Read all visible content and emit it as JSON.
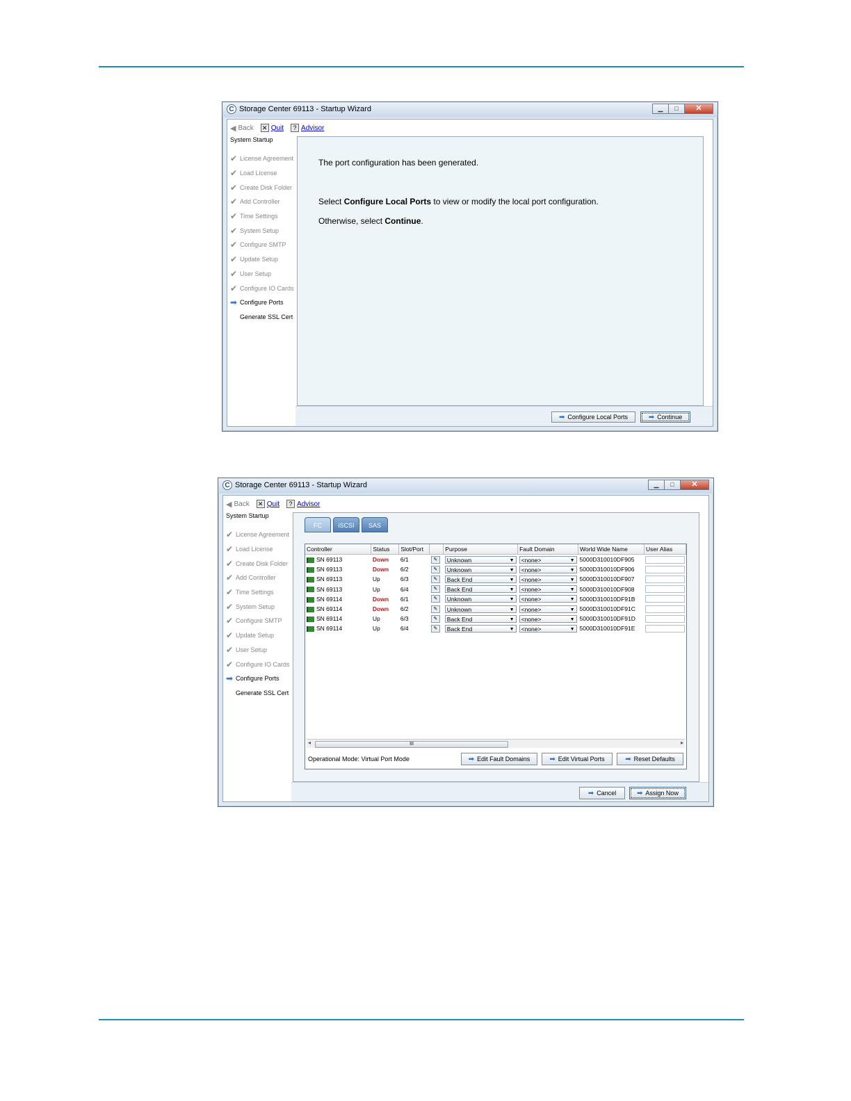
{
  "window_title": "Storage Center 69113 - Startup Wizard",
  "toolbar": {
    "back": "Back",
    "quit": "Quit",
    "advisor": "Advisor"
  },
  "sidebar": {
    "title": "System Startup",
    "items": [
      {
        "label": "License Agreement",
        "state": "done"
      },
      {
        "label": "Load License",
        "state": "done"
      },
      {
        "label": "Create Disk Folder",
        "state": "done"
      },
      {
        "label": "Add Controller",
        "state": "done"
      },
      {
        "label": "Time Settings",
        "state": "done"
      },
      {
        "label": "System Setup",
        "state": "done"
      },
      {
        "label": "Configure SMTP",
        "state": "done"
      },
      {
        "label": "Update Setup",
        "state": "done"
      },
      {
        "label": "User Setup",
        "state": "done"
      },
      {
        "label": "Configure IO Cards",
        "state": "done"
      },
      {
        "label": "Configure Ports",
        "state": "current"
      },
      {
        "label": "Generate SSL Cert",
        "state": "pending"
      }
    ]
  },
  "screen1": {
    "message1": "The port configuration has been generated.",
    "message2_pre": "Select ",
    "message2_bold": "Configure Local Ports",
    "message2_post": " to view or modify the local port configuration.",
    "message3_pre": "Otherwise, select ",
    "message3_bold": "Continue",
    "message3_post": ".",
    "buttons": {
      "configure_local_ports": "Configure Local Ports",
      "continue": "Continue"
    }
  },
  "screen2": {
    "tabs": [
      "FC",
      "iSCSI",
      "SAS"
    ],
    "active_tab": "FC",
    "columns": [
      "Controller",
      "Status",
      "Slot/Port",
      "",
      "Purpose",
      "Fault Domain",
      "World Wide Name",
      "User Alias"
    ],
    "rows": [
      {
        "controller": "SN 69113",
        "status": "Down",
        "slot_port": "6/1",
        "purpose": "Unknown",
        "fault_domain": "<none>",
        "wwn": "5000D310010DF905"
      },
      {
        "controller": "SN 69113",
        "status": "Down",
        "slot_port": "6/2",
        "purpose": "Unknown",
        "fault_domain": "<none>",
        "wwn": "5000D310010DF906"
      },
      {
        "controller": "SN 69113",
        "status": "Up",
        "slot_port": "6/3",
        "purpose": "Back End",
        "fault_domain": "<none>",
        "wwn": "5000D310010DF907"
      },
      {
        "controller": "SN 69113",
        "status": "Up",
        "slot_port": "6/4",
        "purpose": "Back End",
        "fault_domain": "<none>",
        "wwn": "5000D310010DF908"
      },
      {
        "controller": "SN 69114",
        "status": "Down",
        "slot_port": "6/1",
        "purpose": "Unknown",
        "fault_domain": "<none>",
        "wwn": "5000D310010DF91B"
      },
      {
        "controller": "SN 69114",
        "status": "Down",
        "slot_port": "6/2",
        "purpose": "Unknown",
        "fault_domain": "<none>",
        "wwn": "5000D310010DF91C"
      },
      {
        "controller": "SN 69114",
        "status": "Up",
        "slot_port": "6/3",
        "purpose": "Back End",
        "fault_domain": "<none>",
        "wwn": "5000D310010DF91D"
      },
      {
        "controller": "SN 69114",
        "status": "Up",
        "slot_port": "6/4",
        "purpose": "Back End",
        "fault_domain": "<none>",
        "wwn": "5000D310010DF91E"
      }
    ],
    "operational_mode": "Operational Mode: Virtual Port Mode",
    "buttons": {
      "edit_fault_domains": "Edit Fault Domains",
      "edit_virtual_ports": "Edit Virtual Ports",
      "reset_defaults": "Reset Defaults",
      "cancel": "Cancel",
      "assign_now": "Assign Now"
    },
    "scroll_thumb_label": "III"
  },
  "colors": {
    "rule": "#1a8fb0",
    "status_down": "#c0141a",
    "link": "#0000cc",
    "arrow": "#2f6fc0"
  }
}
